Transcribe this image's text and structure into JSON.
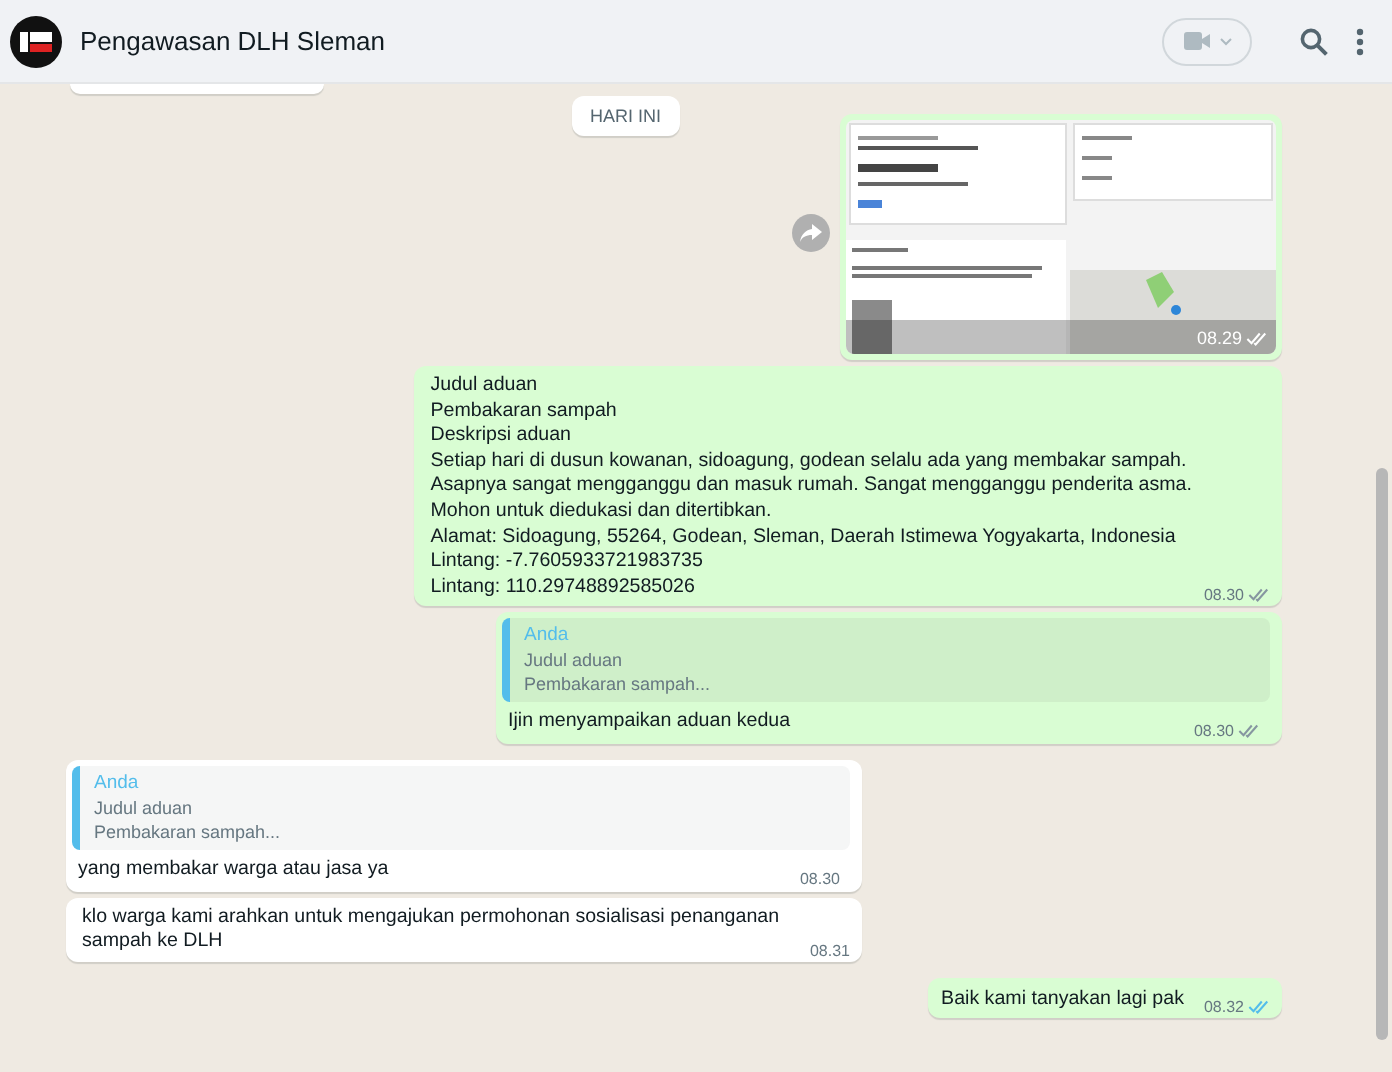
{
  "header": {
    "title": "Pengawasan DLH Sleman"
  },
  "date_chip": "HARI INI",
  "messages": [
    {
      "kind": "image",
      "outgoing": true,
      "time": "08.29",
      "read": false
    },
    {
      "kind": "text",
      "outgoing": true,
      "text": "Judul aduan\nPembakaran sampah\nDeskripsi aduan\nSetiap hari di dusun kowanan, sidoagung, godean selalu ada yang membakar sampah.\nAsapnya sangat mengganggu dan masuk rumah. Sangat mengganggu penderita asma.\nMohon untuk diedukasi dan ditertibkan.\nAlamat: Sidoagung, 55264, Godean, Sleman, Daerah Istimewa Yogyakarta, Indonesia\nLintang: -7.7605933721983735\nLintang: 110.29748892585026",
      "time": "08.30",
      "read": false
    },
    {
      "kind": "reply",
      "outgoing": true,
      "quote": {
        "author": "Anda",
        "lines": [
          "Judul aduan",
          "Pembakaran sampah..."
        ]
      },
      "text": "Ijin menyampaikan aduan kedua",
      "time": "08.30",
      "read": false
    },
    {
      "kind": "reply",
      "outgoing": false,
      "quote": {
        "author": "Anda",
        "lines": [
          "Judul aduan",
          "Pembakaran sampah..."
        ]
      },
      "text": "yang membakar warga atau jasa ya",
      "time": "08.30"
    },
    {
      "kind": "text",
      "outgoing": false,
      "text": "klo warga kami arahkan untuk mengajukan permohonan sosialisasi penanganan sampah ke DLH",
      "time": "08.31"
    },
    {
      "kind": "short",
      "outgoing": true,
      "text": "Baik kami tanyakan lagi pak",
      "time": "08.32",
      "read": true
    }
  ]
}
